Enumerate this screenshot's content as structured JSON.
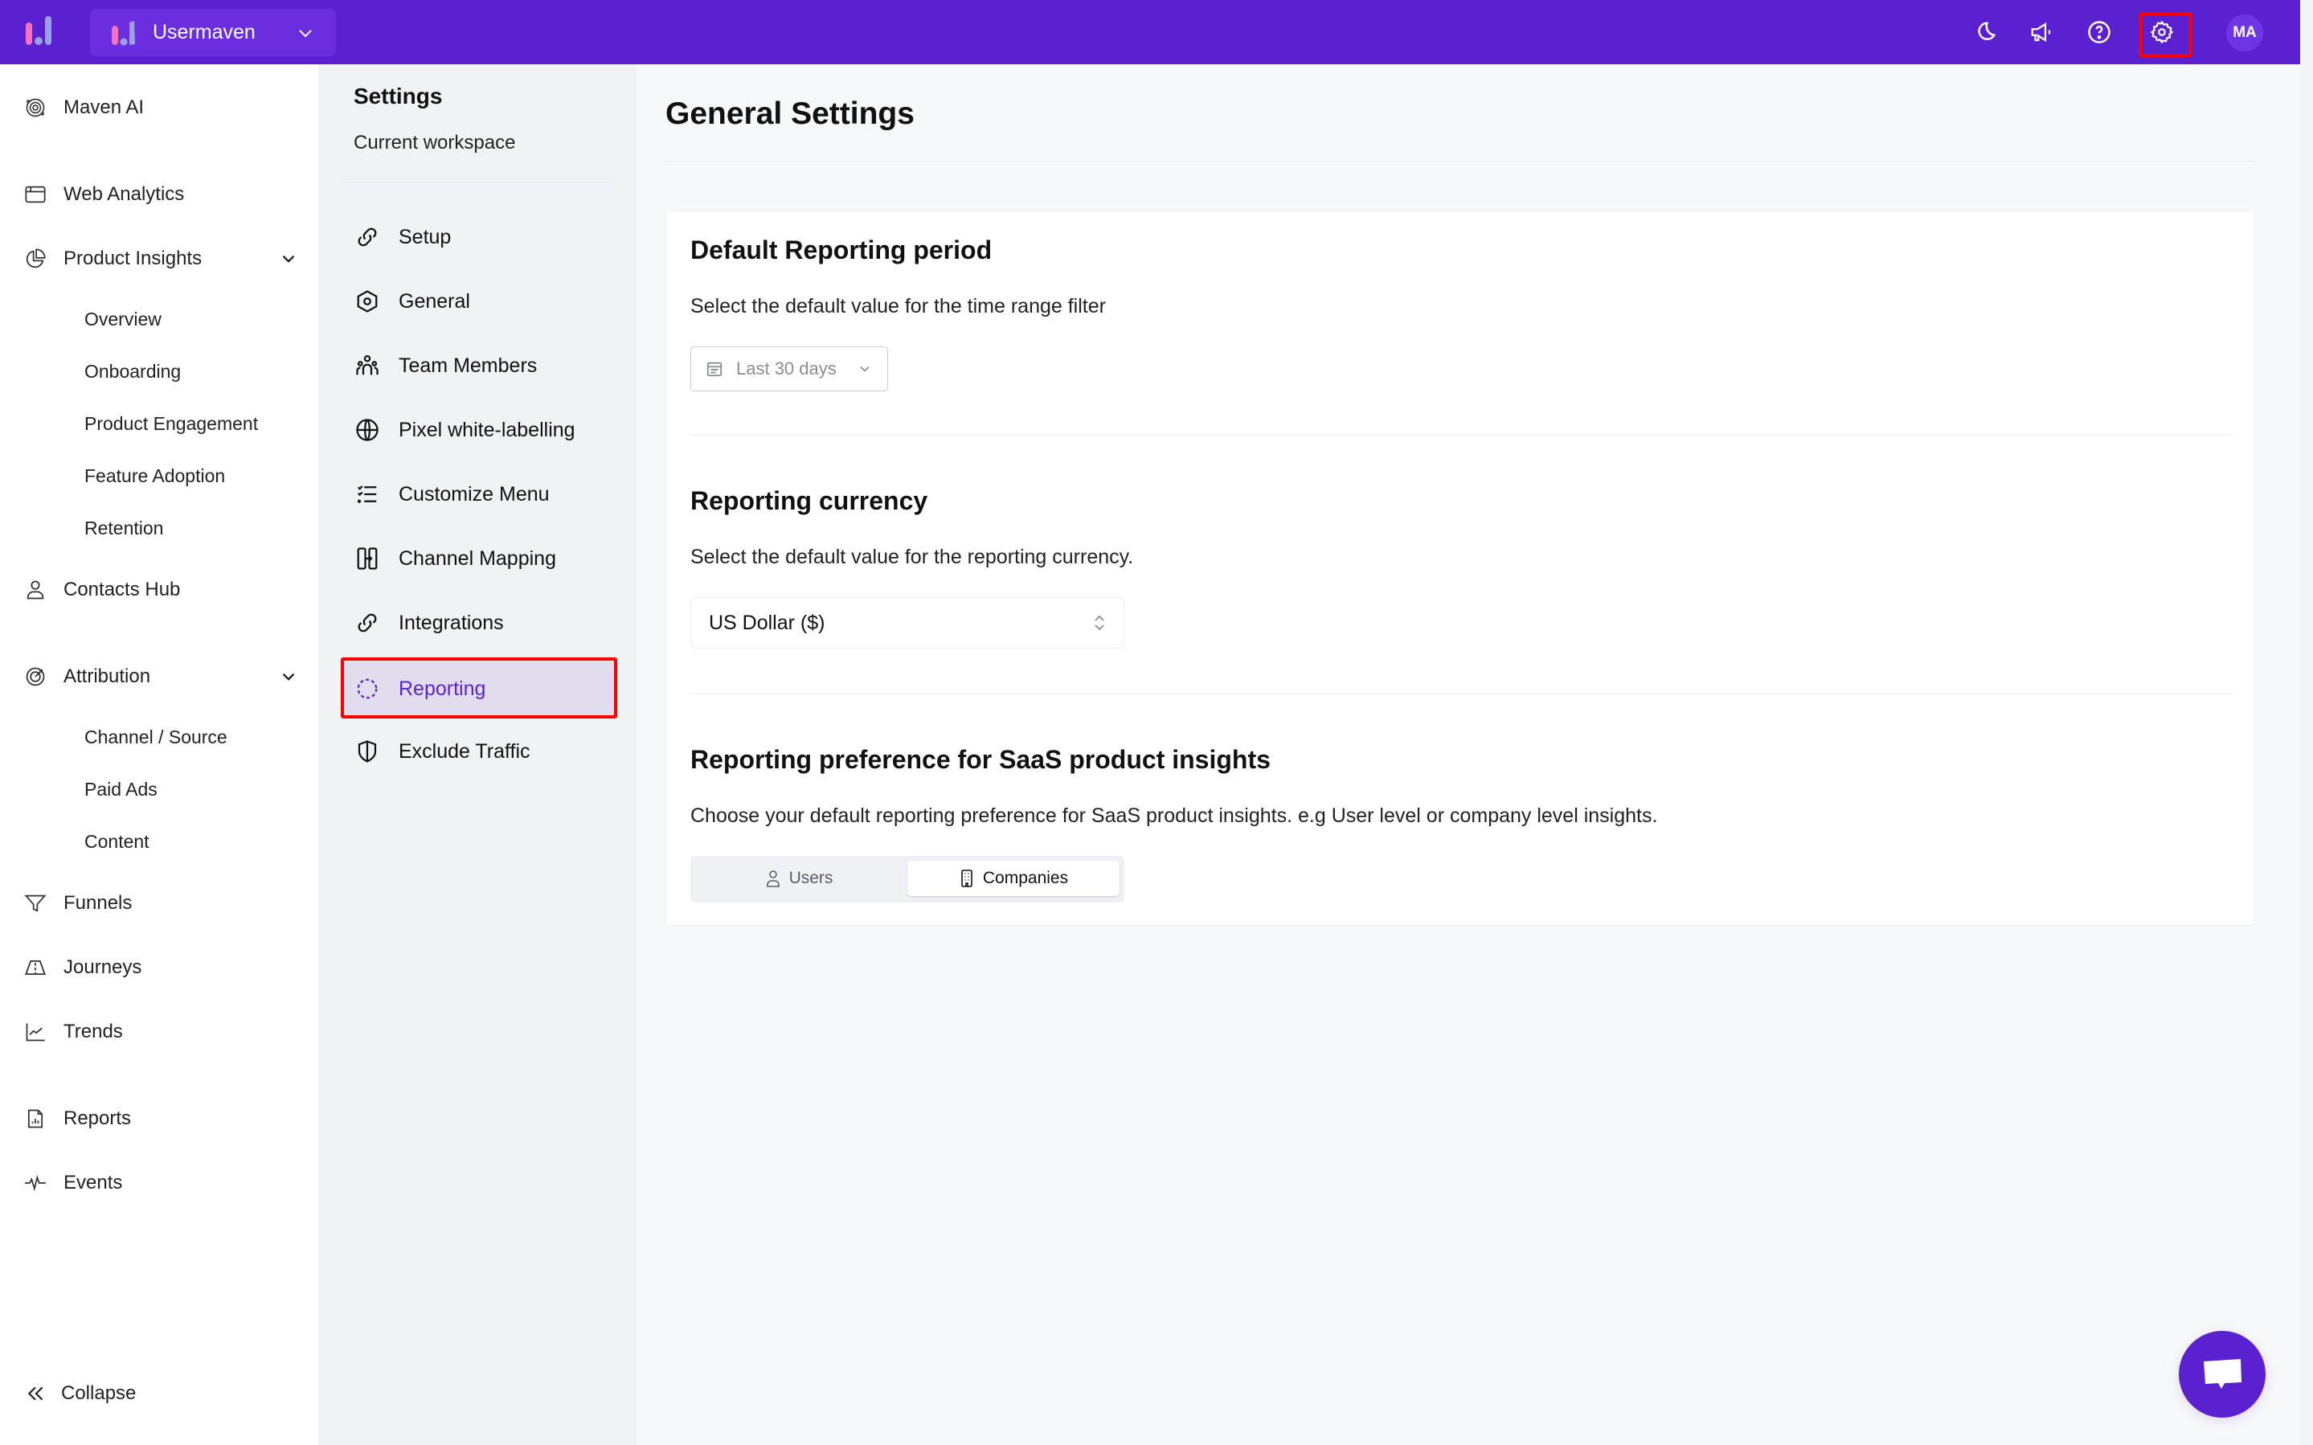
{
  "topbar": {
    "workspace_name": "Usermaven",
    "avatar_initials": "MA",
    "icons": [
      "moon-icon",
      "megaphone-icon",
      "help-icon",
      "gear-icon"
    ],
    "brand_color": "#5b21d1"
  },
  "leftnav": {
    "items": [
      {
        "label": "Maven AI",
        "icon": "maven-ai-icon"
      },
      {
        "label": "Web Analytics",
        "icon": "browser-window-icon"
      },
      {
        "label": "Product Insights",
        "icon": "pie-chart-icon",
        "expanded": true,
        "children": [
          "Overview",
          "Onboarding",
          "Product Engagement",
          "Feature Adoption",
          "Retention"
        ]
      },
      {
        "label": "Contacts Hub",
        "icon": "user-icon"
      },
      {
        "label": "Attribution",
        "icon": "target-icon",
        "expanded": true,
        "children": [
          "Channel / Source",
          "Paid Ads",
          "Content"
        ]
      },
      {
        "label": "Funnels",
        "icon": "funnel-icon"
      },
      {
        "label": "Journeys",
        "icon": "road-icon"
      },
      {
        "label": "Trends",
        "icon": "line-chart-icon"
      },
      {
        "label": "Reports",
        "icon": "report-file-icon"
      },
      {
        "label": "Events",
        "icon": "activity-icon"
      }
    ],
    "collapse_label": "Collapse"
  },
  "settings_nav": {
    "title": "Settings",
    "subtitle": "Current workspace",
    "items": [
      {
        "label": "Setup",
        "icon": "link-icon"
      },
      {
        "label": "General",
        "icon": "hex-gear-icon"
      },
      {
        "label": "Team Members",
        "icon": "team-icon"
      },
      {
        "label": "Pixel white-labelling",
        "icon": "globe-icon"
      },
      {
        "label": "Customize Menu",
        "icon": "checklist-icon"
      },
      {
        "label": "Channel Mapping",
        "icon": "mapping-icon"
      },
      {
        "label": "Integrations",
        "icon": "link-icon"
      },
      {
        "label": "Reporting",
        "icon": "dashed-circle-icon",
        "active": true
      },
      {
        "label": "Exclude Traffic",
        "icon": "shield-icon"
      }
    ]
  },
  "main": {
    "page_title": "General Settings",
    "sections": {
      "period": {
        "title": "Default Reporting period",
        "description": "Select the default value for the time range filter",
        "selected": "Last 30 days"
      },
      "currency": {
        "title": "Reporting currency",
        "description": "Select the default value for the reporting currency.",
        "selected": "US Dollar ($)"
      },
      "preference": {
        "title": "Reporting preference for SaaS product insights",
        "description": "Choose your default reporting preference for SaaS product insights. e.g User level or company level insights.",
        "options": [
          "Users",
          "Companies"
        ],
        "selected": "Companies"
      }
    }
  }
}
